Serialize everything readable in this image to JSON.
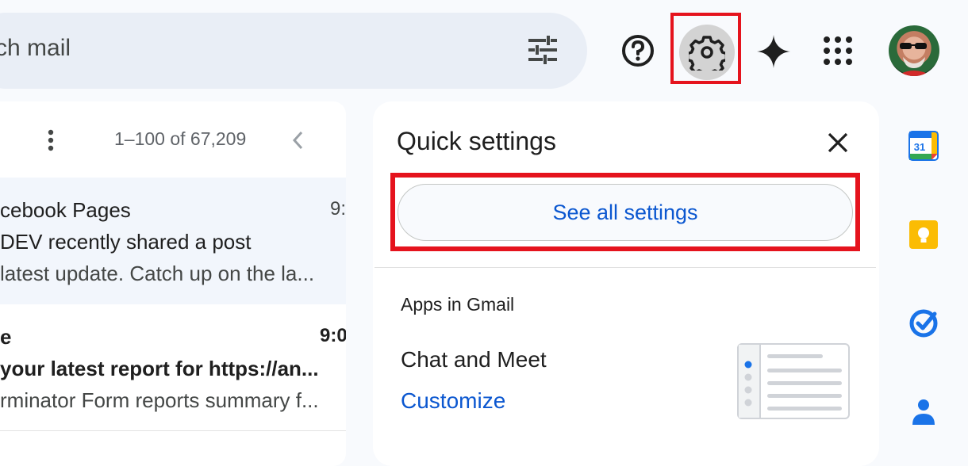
{
  "header": {
    "search_placeholder": "Search mail",
    "search_visible": "ch mail",
    "icons": [
      "tune-icon",
      "help-icon",
      "settings-icon",
      "gemini-icon",
      "apps-grid-icon",
      "avatar"
    ]
  },
  "mail_list": {
    "pagination": "1–100 of 67,209",
    "rows": [
      {
        "sender": "cebook Pages",
        "time": "9:",
        "subject": "DEV recently shared a post",
        "snippet": " latest update. Catch up on the la..."
      },
      {
        "sender": "e",
        "time": "9:0",
        "subject": "your latest report for https://an...",
        "snippet": "rminator Form reports summary f..."
      }
    ]
  },
  "quick_settings": {
    "title": "Quick settings",
    "see_all_button": "See all settings",
    "apps_heading": "Apps in Gmail",
    "chat_label": "Chat and Meet",
    "customize_link": "Customize"
  },
  "side_apps": {
    "calendar_day": "31",
    "items": [
      "calendar-icon",
      "keep-icon",
      "tasks-icon",
      "contacts-icon"
    ]
  },
  "colors": {
    "highlight": "#e5131d",
    "link_blue": "#0b57d0",
    "background": "#f8fafd"
  }
}
